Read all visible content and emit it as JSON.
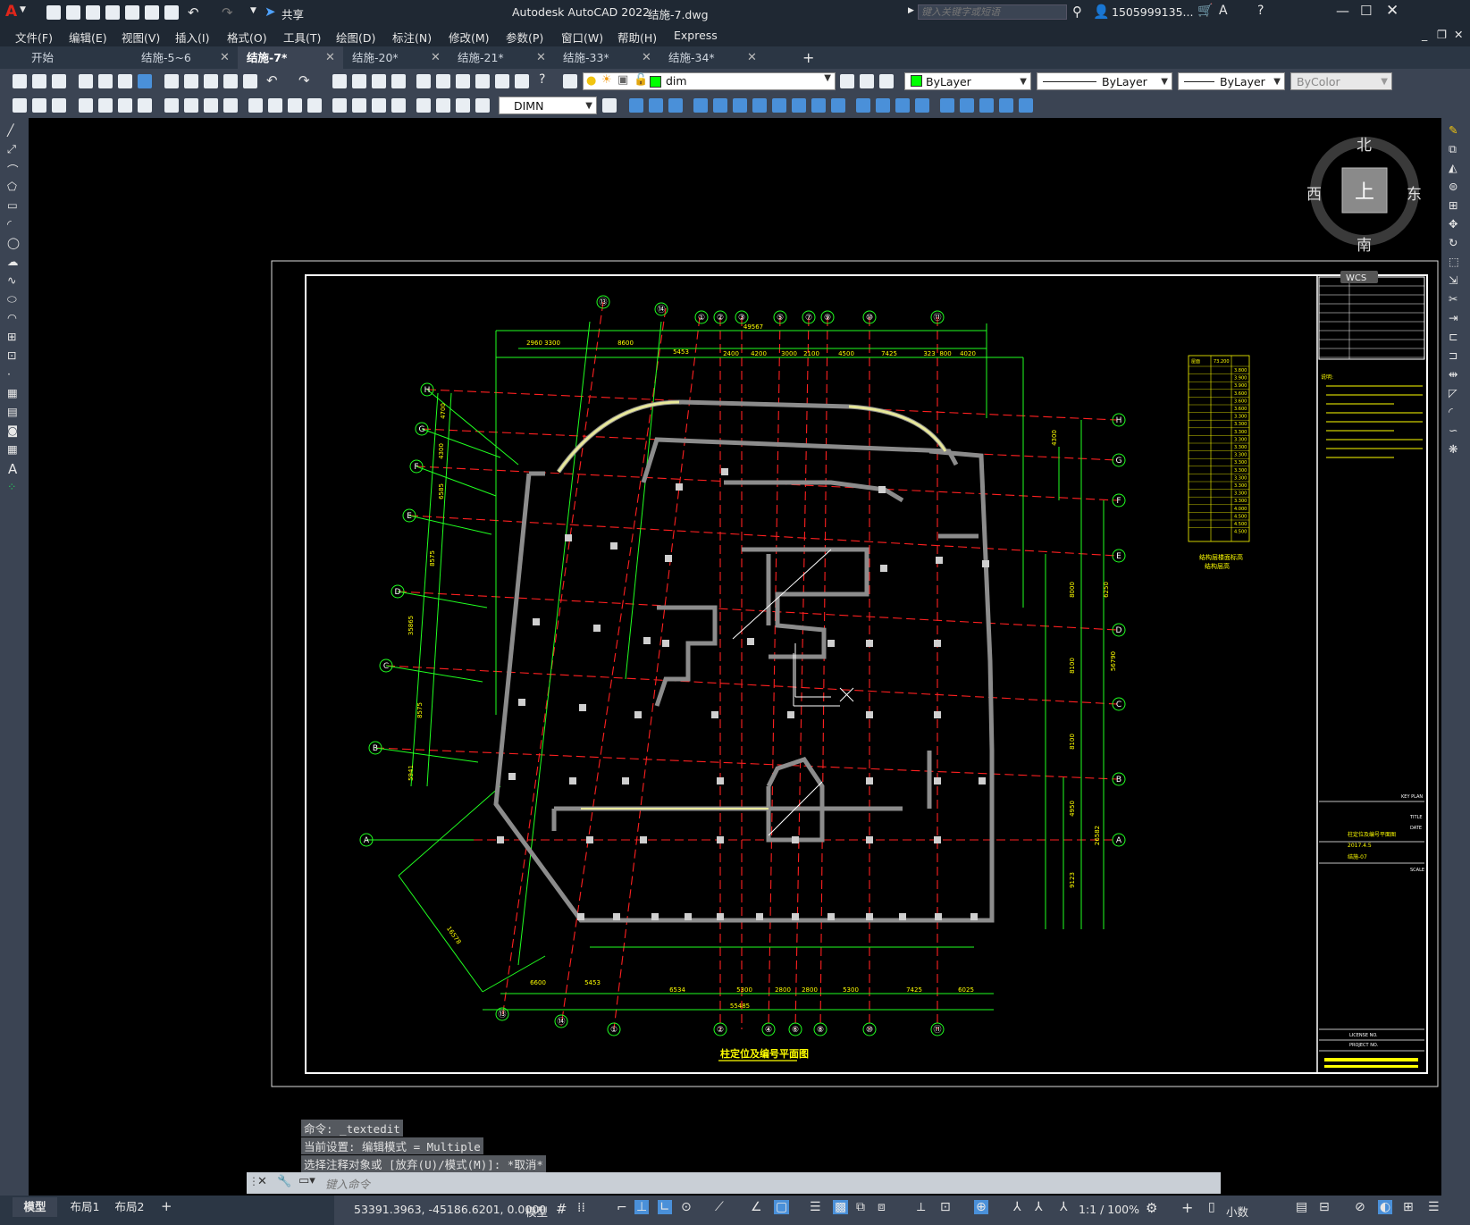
{
  "app": {
    "title": "Autodesk AutoCAD 2022",
    "filename": "结施-7.dwg",
    "share_label": "共享",
    "search_placeholder": "键入关键字或短语",
    "user": "1505999135..."
  },
  "menu": [
    "文件(F)",
    "编辑(E)",
    "视图(V)",
    "插入(I)",
    "格式(O)",
    "工具(T)",
    "绘图(D)",
    "标注(N)",
    "修改(M)",
    "参数(P)",
    "窗口(W)",
    "帮助(H)",
    "Express"
  ],
  "tabs": [
    {
      "label": "开始",
      "closable": false,
      "active": false
    },
    {
      "label": "结施-5~6",
      "closable": true,
      "active": false
    },
    {
      "label": "结施-7*",
      "closable": true,
      "active": true
    },
    {
      "label": "结施-20*",
      "closable": true,
      "active": false
    },
    {
      "label": "结施-21*",
      "closable": true,
      "active": false
    },
    {
      "label": "结施-33*",
      "closable": true,
      "active": false
    },
    {
      "label": "结施-34*",
      "closable": true,
      "active": false
    }
  ],
  "toolbar": {
    "layer": "dim",
    "color": "ByLayer",
    "linetype": "ByLayer",
    "lineweight": "ByLayer",
    "plotstyle": "ByColor",
    "dimstyle": "DIMN"
  },
  "viewcube": {
    "north": "北",
    "south": "南",
    "east": "东",
    "west": "西",
    "top": "上",
    "wcs": "WCS"
  },
  "drawing": {
    "title": "柱定位及编号平面图",
    "grid_top": [
      "⑬",
      "⑭",
      "①",
      "②",
      "③",
      "⑤",
      "⑦",
      "⑨",
      "⑩",
      "⑪"
    ],
    "grid_bottom": [
      "⑬",
      "⑭",
      "①",
      "②",
      "④",
      "⑥",
      "⑧",
      "⑩",
      "⑪"
    ],
    "grid_left": [
      "H",
      "G",
      "F",
      "E",
      "D",
      "C",
      "B",
      "A"
    ],
    "grid_right": [
      "H",
      "G",
      "F",
      "E",
      "D",
      "C",
      "B",
      "A"
    ],
    "dims_top": [
      "2960",
      "3300",
      "8600",
      "5453",
      "2400",
      "4200",
      "3000",
      "2100",
      "4500",
      "7425",
      "323",
      "800",
      "4020"
    ],
    "dim_overall_top": "49567",
    "dims_bottom": [
      "6600",
      "5453",
      "6534",
      "5300",
      "2800",
      "2800",
      "5300",
      "7425",
      "6025"
    ],
    "dim_overall_bottom": "55485",
    "dims_right": [
      "4300",
      "6250",
      "8000",
      "8100",
      "8100",
      "4950",
      "9123",
      "26582",
      "56790"
    ],
    "dims_left": [
      "4700",
      "4300",
      "6585",
      "8575",
      "35865",
      "8575",
      "5941"
    ],
    "diag_dim": "16578",
    "elev_table_header": [
      "屋面",
      "73.200"
    ],
    "elev_rows": [
      "3.800",
      "3.900",
      "3.900",
      "3.600",
      "3.600",
      "3.600",
      "3.300",
      "3.300",
      "3.300",
      "3.300",
      "3.300",
      "3.300",
      "3.300",
      "3.300",
      "3.300",
      "3.300",
      "3.300",
      "3.300",
      "4.000",
      "4.500",
      "4.500",
      "4.500"
    ],
    "elev_caption": "结构层楼面标高",
    "elev_caption2": "结构层高",
    "titleblock_labels": [
      "KEY PLAN",
      "TITLE",
      "DATE",
      "SCALE",
      "LICENSE NO.",
      "PROJECT NO."
    ],
    "titleblock_title": "柱定位及编号平面图",
    "titleblock_date": "2017.4.5",
    "titleblock_sheet": "结施-07",
    "notes_title": "说明:"
  },
  "command": {
    "history": [
      "命令: _textedit",
      "当前设置: 编辑模式 = Multiple",
      "选择注释对象或 [放弃(U)/模式(M)]: *取消*"
    ],
    "placeholder": "键入命令"
  },
  "layouts": [
    "模型",
    "布局1",
    "布局2"
  ],
  "status": {
    "coords": "53391.3963, -45186.6201, 0.0000",
    "model": "模型",
    "scale": "1:1 / 100%",
    "units": "小数"
  },
  "colors": {
    "grid": "#ff2020",
    "dims": "#20ff20",
    "walls": "#909090",
    "text": "#ffff00",
    "bubble": "#20ff20",
    "panel": "#3b4453"
  }
}
